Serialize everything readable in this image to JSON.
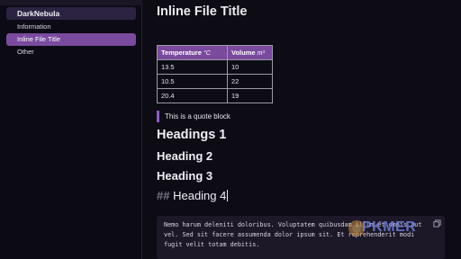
{
  "sidebar": {
    "vault_name": "DarkNebula",
    "items": [
      {
        "label": "Information"
      },
      {
        "label": "Inline File Title"
      },
      {
        "label": "Other"
      }
    ]
  },
  "main": {
    "title": "Inline File Title",
    "table": {
      "headers": [
        "Temperature",
        "Volume"
      ],
      "header_units": [
        "°C",
        "m³"
      ],
      "rows": [
        [
          "13.5",
          "10"
        ],
        [
          "10.5",
          "22"
        ],
        [
          "20.4",
          "19"
        ]
      ]
    },
    "quote": "This is a quote block",
    "headings": {
      "h1": "Headings 1",
      "h2": "Heading 2",
      "h3": "Heading 3",
      "h4_marker": "##",
      "h4": "Heading 4"
    },
    "code": {
      "lines": [
        "Nemo harum deleniti doloribus. Voluptatem quibusdam illum et omnis aut",
        "vel. Sed sit facere assumenda dolor ipsum sit. Et reprehenderit modi",
        "fugit velit totam debitis."
      ]
    },
    "watermark": "PKMER"
  },
  "colors": {
    "accent": "#7a4a9e",
    "quote_border": "#8a5cc8",
    "background": "#0d0b14"
  }
}
